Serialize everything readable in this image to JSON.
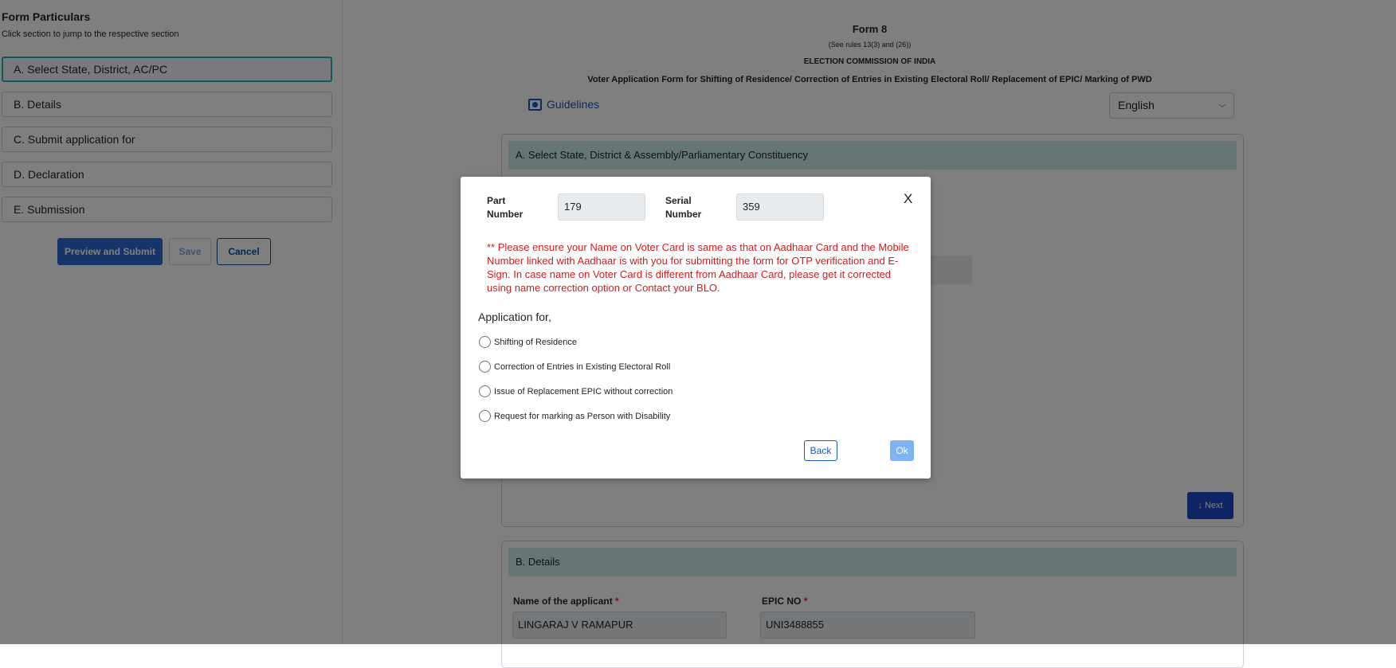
{
  "sidebar": {
    "title": "Form Particulars",
    "subtitle": "Click section to jump to the respective section",
    "sections": [
      "A. Select State, District, AC/PC",
      "B. Details",
      "C. Submit application for",
      "D. Declaration",
      "E. Submission"
    ],
    "buttons": {
      "preview": "Preview and Submit",
      "save": "Save",
      "cancel": "Cancel"
    }
  },
  "header": {
    "title": "Form 8",
    "rules": "(See rules 13(3) and (26))",
    "org": "ELECTION COMMISSION OF INDIA",
    "description": "Voter Application Form for Shifting of Residence/ Correction of Entries in Existing Electoral Roll/ Replacement of EPIC/ Marking of PWD",
    "guidelines": "Guidelines",
    "language": "English"
  },
  "sectionA": {
    "header": "A. Select State, District & Assembly/Parliamentary Constituency",
    "next": "↓ Next"
  },
  "sectionB": {
    "header": "B. Details",
    "name_label": "Name of the applicant",
    "name_value": "LINGARAJ V RAMAPUR",
    "epic_label": "EPIC NO",
    "epic_value": "UNI3488855",
    "required": "*"
  },
  "modal": {
    "part_label": "Part Number",
    "part_value": "179",
    "serial_label": "Serial Number",
    "serial_value": "359",
    "close": "X",
    "warning": "** Please ensure your Name on Voter Card is same as that on Aadhaar Card and the Mobile Number linked with Aadhaar is with you for submitting the form for OTP verification and E-Sign. In case name on Voter Card is different from Aadhaar Card, please get it corrected using name correction option or Contact your BLO.",
    "application_for": "Application for,",
    "options": [
      "Shifting of Residence",
      "Correction of Entries in Existing Electoral Roll",
      "Issue of Replacement EPIC without correction",
      "Request for marking as Person with Disability"
    ],
    "back": "Back",
    "ok": "Ok"
  }
}
